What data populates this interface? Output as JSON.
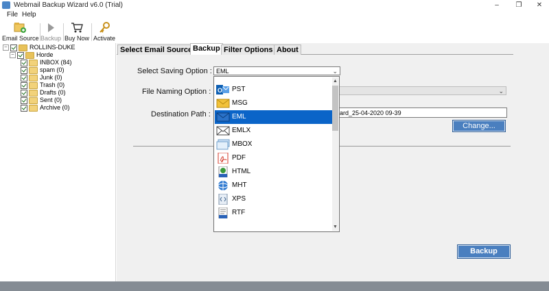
{
  "window": {
    "title": "Webmail Backup Wizard v6.0 (Trial)",
    "controls": [
      "–",
      "❐",
      "✕"
    ]
  },
  "menu": [
    "File",
    "Help"
  ],
  "toolbar": {
    "email_source": "Email Source",
    "backup": "Backup",
    "buy_now": "Buy Now",
    "activate": "Activate"
  },
  "tree": {
    "root": "ROLLINS-DUKE",
    "account": "Horde",
    "folders": [
      "INBOX (84)",
      "spam (0)",
      "Junk (0)",
      "Trash (0)",
      "Drafts (0)",
      "Sent (0)",
      "Archive (0)"
    ]
  },
  "tabs": [
    "Select Email Source",
    "Backup",
    "Filter Options",
    "About"
  ],
  "form": {
    "saving_label": "Select Saving Option :",
    "saving_value": "EML",
    "naming_label": "File Naming Option :",
    "destination_label": "Destination Path :",
    "destination_value": "ard_25-04-2020 09-39",
    "change_button": "Change...",
    "backup_button": "Backup"
  },
  "dropdown": {
    "options": [
      "PST",
      "MSG",
      "EML",
      "EMLX",
      "MBOX",
      "PDF",
      "HTML",
      "MHT",
      "XPS",
      "RTF"
    ],
    "selected_index": 2,
    "icons": [
      "outlook-icon",
      "envelope-icon",
      "eml-icon",
      "emlx-icon",
      "mbox-icon",
      "pdf-icon",
      "html-icon",
      "mht-icon",
      "xps-icon",
      "rtf-icon"
    ]
  },
  "colors": {
    "selection": "#0a64c8",
    "button": "#4a7fbf",
    "status_bar": "#858c94"
  }
}
